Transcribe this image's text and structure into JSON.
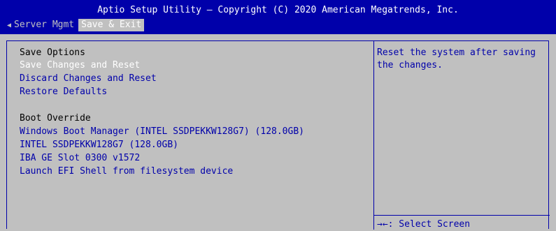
{
  "header": {
    "title": "Aptio Setup Utility – Copyright (C) 2020 American Megatrends, Inc.",
    "tabs": [
      {
        "label": "Server Mgmt"
      },
      {
        "label": "Save & Exit"
      }
    ]
  },
  "main": {
    "save_options": {
      "heading": "Save Options",
      "items": [
        {
          "label": "Save Changes and Reset"
        },
        {
          "label": "Discard Changes and Reset"
        },
        {
          "label": "Restore Defaults"
        }
      ]
    },
    "boot_override": {
      "heading": "Boot Override",
      "items": [
        {
          "label": "Windows Boot Manager (INTEL SSDPEKKW128G7) (128.0GB)"
        },
        {
          "label": "INTEL SSDPEKKW128G7 (128.0GB)"
        },
        {
          "label": "IBA GE Slot 0300 v1572"
        },
        {
          "label": "Launch EFI Shell from filesystem device"
        }
      ]
    }
  },
  "help": {
    "description_line1": "Reset the system after saving",
    "description_line2": "the changes.",
    "key_hint": "→←: Select Screen"
  },
  "colors": {
    "background": "#c0c0c0",
    "header": "#0000aa",
    "item_text": "#0000aa",
    "selected_text": "#ffffff"
  }
}
